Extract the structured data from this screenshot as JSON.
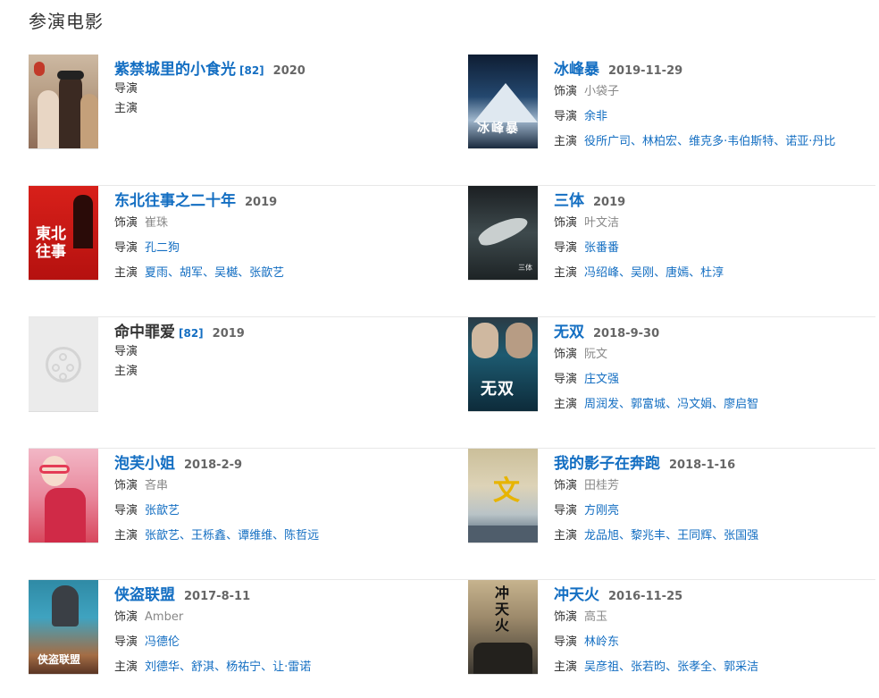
{
  "section": {
    "title": "参演电影"
  },
  "labels": {
    "role": "饰演",
    "director": "导演",
    "cast": "主演"
  },
  "films": [
    {
      "title": "紫禁城里的小食光",
      "ref": "[82]",
      "date": "2020",
      "role": "",
      "director": "",
      "cast": []
    },
    {
      "title": "冰峰暴",
      "ref": "",
      "date": "2019-11-29",
      "role": "小袋子",
      "director": "余非",
      "cast": [
        "役所广司",
        "林柏宏",
        "维克多·韦伯斯特",
        "诺亚·丹比"
      ]
    },
    {
      "title": "东北往事之二十年",
      "ref": "",
      "date": "2019",
      "role": "崔珠",
      "director": "孔二狗",
      "cast": [
        "夏雨",
        "胡军",
        "吴樾",
        "张歆艺"
      ]
    },
    {
      "title": "三体",
      "ref": "",
      "date": "2019",
      "role": "叶文洁",
      "director": "张番番",
      "cast": [
        "冯绍峰",
        "吴刚",
        "唐嫣",
        "杜淳"
      ]
    },
    {
      "title": "命中罪爱",
      "ref": "[82]",
      "date": "2019",
      "role": "",
      "director": "",
      "cast": []
    },
    {
      "title": "无双",
      "ref": "",
      "date": "2018-9-30",
      "role": "阮文",
      "director": "庄文强",
      "cast": [
        "周润发",
        "郭富城",
        "冯文娟",
        "廖启智"
      ]
    },
    {
      "title": "泡芙小姐",
      "ref": "",
      "date": "2018-2-9",
      "role": "吝串",
      "director": "张歆艺",
      "cast": [
        "张歆艺",
        "王栎鑫",
        "谭维维",
        "陈哲远"
      ]
    },
    {
      "title": "我的影子在奔跑",
      "ref": "",
      "date": "2018-1-16",
      "role": "田桂芳",
      "director": "方刚亮",
      "cast": [
        "龙品旭",
        "黎兆丰",
        "王同辉",
        "张国强"
      ]
    },
    {
      "title": "侠盗联盟",
      "ref": "",
      "date": "2017-8-11",
      "role": "Amber",
      "director": "冯德伦",
      "cast": [
        "刘德华",
        "舒淇",
        "杨祐宁",
        "让·雷诺"
      ]
    },
    {
      "title": "冲天火",
      "ref": "",
      "date": "2016-11-25",
      "role": "高玉",
      "director": "林岭东",
      "cast": [
        "吴彦祖",
        "张若昀",
        "张孝全",
        "郭采洁"
      ]
    }
  ]
}
